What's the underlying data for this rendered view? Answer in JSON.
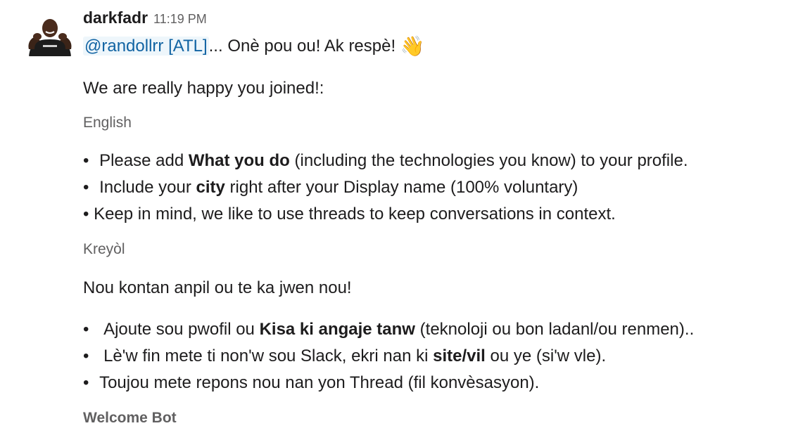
{
  "message": {
    "sender": "darkfadr",
    "timestamp": "11:19 PM",
    "mention": "@randollrr [ATL]",
    "greeting_rest": "... Onè pou ou! Ak respè!",
    "wave_emoji": "👋",
    "welcome_line": "We are really happy you joined!:",
    "english": {
      "label": "English",
      "bullets": [
        {
          "bullet": "•",
          "pre": "Please add ",
          "bold": "What you do",
          "post": " (including the technologies you know) to your profile."
        },
        {
          "bullet": "•",
          "pre": "Include your ",
          "bold": "city",
          "post": " right after your Display name (100% voluntary)"
        },
        {
          "bullet": "•",
          "text": "Keep in mind, we like to use threads to keep conversations in context."
        }
      ]
    },
    "kreyol": {
      "label": "Kreyòl",
      "intro": "Nou kontan anpil ou te ka jwen nou!",
      "bullets": [
        {
          "bullet": "•",
          "pre": "Ajoute sou pwofil ou ",
          "bold": "Kisa ki angaje tanw",
          "post": " (teknoloji ou bon ladanl/ou renmen).."
        },
        {
          "bullet": "•",
          "pre": "Lè'w fin mete ti non'w sou Slack, ekri nan ki ",
          "bold": "site/vil",
          "post": " ou ye (si'w vle)."
        },
        {
          "bullet": "•",
          "text": "Toujou mete repons nou nan yon Thread (fil konvèsasyon)."
        }
      ]
    },
    "footer": "Welcome Bot"
  },
  "colors": {
    "text": "#1d1c1d",
    "muted": "#616061",
    "mention_text": "#1264a3",
    "mention_bg": "#eef6fb"
  }
}
